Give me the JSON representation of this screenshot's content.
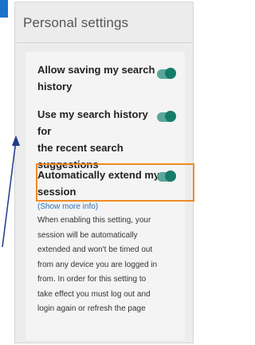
{
  "panel": {
    "title": "Personal settings"
  },
  "settings": [
    {
      "label_line1": "Allow saving my search",
      "label_line2": "history",
      "enabled": true
    },
    {
      "label_line1": "Use my search history for",
      "label_line2": "the recent search",
      "label_line3": "suggestions",
      "enabled": true
    },
    {
      "label_line1": "Automatically extend my",
      "label_line2": "session",
      "enabled": true
    }
  ],
  "more_info": "(Show more info)",
  "description_lines": [
    "When enabling this setting, your",
    "session will be automatically",
    "extended and won't be timed out",
    "from any device you are logged in",
    "from. In order for this setting to",
    "take effect you must log out and",
    "login again or refresh the page"
  ],
  "colors": {
    "toggle_track": "#5aa79a",
    "toggle_knob": "#167c6a",
    "highlight": "#f08a24",
    "arrow": "#1f3a8a",
    "link": "#2e6db4"
  }
}
